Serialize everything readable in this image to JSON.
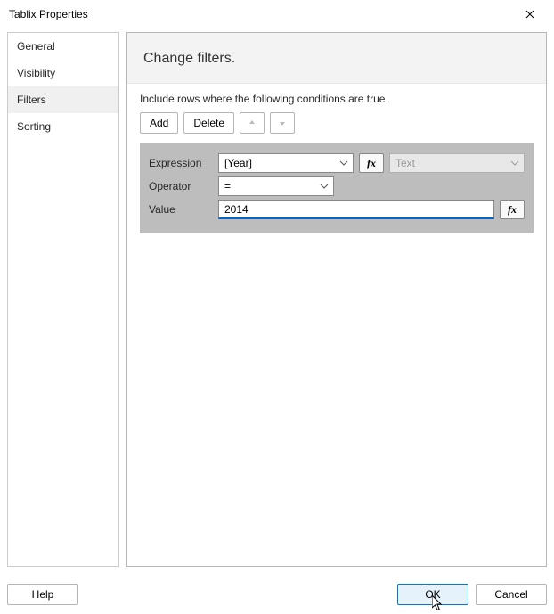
{
  "window": {
    "title": "Tablix Properties"
  },
  "sidebar": {
    "items": [
      {
        "label": "General"
      },
      {
        "label": "Visibility"
      },
      {
        "label": "Filters"
      },
      {
        "label": "Sorting"
      }
    ]
  },
  "content": {
    "heading": "Change filters.",
    "instruction": "Include rows where the following conditions are true.",
    "toolbar": {
      "add": "Add",
      "delete": "Delete"
    },
    "filter": {
      "expressionLabel": "Expression",
      "expressionValue": "[Year]",
      "typeValue": "Text",
      "operatorLabel": "Operator",
      "operatorValue": "=",
      "valueLabel": "Value",
      "valueValue": "2014",
      "fxLabel": "fx"
    }
  },
  "footer": {
    "help": "Help",
    "ok": "OK",
    "cancel": "Cancel"
  }
}
